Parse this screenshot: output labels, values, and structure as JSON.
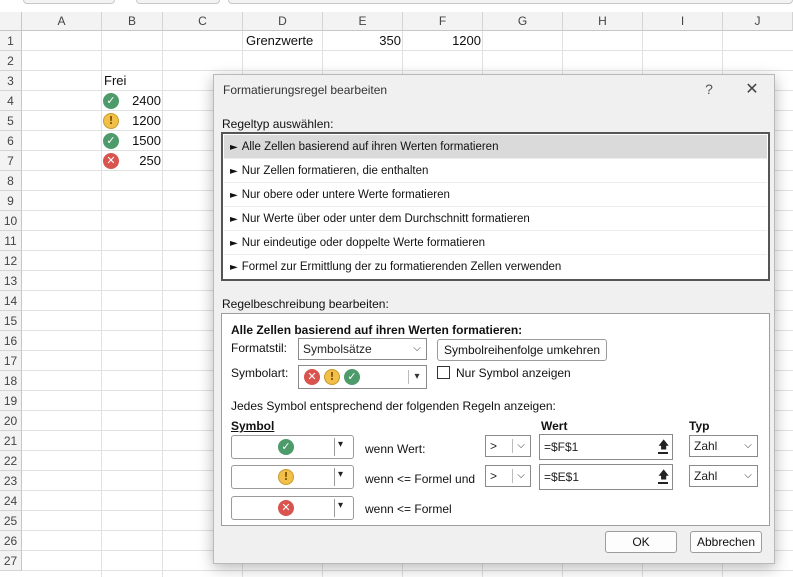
{
  "sheet": {
    "columns": [
      "A",
      "B",
      "C",
      "D",
      "E",
      "F",
      "G",
      "H",
      "I",
      "J"
    ],
    "rows": [
      "1",
      "2",
      "3",
      "4",
      "5",
      "6",
      "7",
      "8",
      "9",
      "10",
      "11",
      "12",
      "13",
      "14",
      "15",
      "16",
      "17",
      "18",
      "19",
      "20",
      "21",
      "22",
      "23",
      "24",
      "25",
      "26",
      "27"
    ],
    "cells": {
      "d1": "Grenzwerte",
      "e1": "350",
      "f1": "1200",
      "b3": "Frei",
      "b4": "2400",
      "b5": "1200",
      "b6": "1500",
      "b7": "250"
    },
    "icons": {
      "b4": "check-icon",
      "b5": "exclamation-icon",
      "b6": "check-icon",
      "b7": "cross-icon"
    }
  },
  "dialog": {
    "title": "Formatierungsregel bearbeiten",
    "help": "?",
    "close": "✕",
    "ruletype_label": "Regeltyp auswählen:",
    "ruletypes": [
      "Alle Zellen basierend auf ihren Werten formatieren",
      "Nur Zellen formatieren, die enthalten",
      "Nur obere oder untere Werte formatieren",
      "Nur Werte über oder unter dem Durchschnitt formatieren",
      "Nur eindeutige oder doppelte Werte formatieren",
      "Formel zur Ermittlung der zu formatierenden Zellen verwenden"
    ],
    "selected_ruletype_index": 0,
    "desc_label": "Regelbeschreibung bearbeiten:",
    "desc": {
      "heading": "Alle Zellen basierend auf ihren Werten formatieren:",
      "formatstil_label": "Formatstil:",
      "formatstil_value": "Symbolsätze",
      "reverse_button": "Symbolreihenfolge umkehren",
      "symbolart_label": "Symbolart:",
      "only_symbol_label": "Nur Symbol anzeigen",
      "only_symbol_checked": false,
      "rules_intro": "Jedes Symbol entsprechend der folgenden Regeln anzeigen:",
      "col_symbol": "Symbol",
      "col_wert": "Wert",
      "col_typ": "Typ",
      "rules": [
        {
          "icon": "check-icon",
          "condition": "wenn Wert:",
          "operator": ">",
          "value": "=$F$1",
          "type": "Zahl"
        },
        {
          "icon": "exclamation-icon",
          "condition": "wenn <= Formel und",
          "operator": ">",
          "value": "=$E$1",
          "type": "Zahl"
        },
        {
          "icon": "cross-icon",
          "condition": "wenn <= Formel"
        }
      ]
    },
    "ok": "OK",
    "cancel": "Abbrechen"
  },
  "colors": {
    "ok_icon": "#4d9a6b",
    "warn_icon": "#f0c04a",
    "err_icon": "#d9534f",
    "selected_row": "#dadada"
  }
}
